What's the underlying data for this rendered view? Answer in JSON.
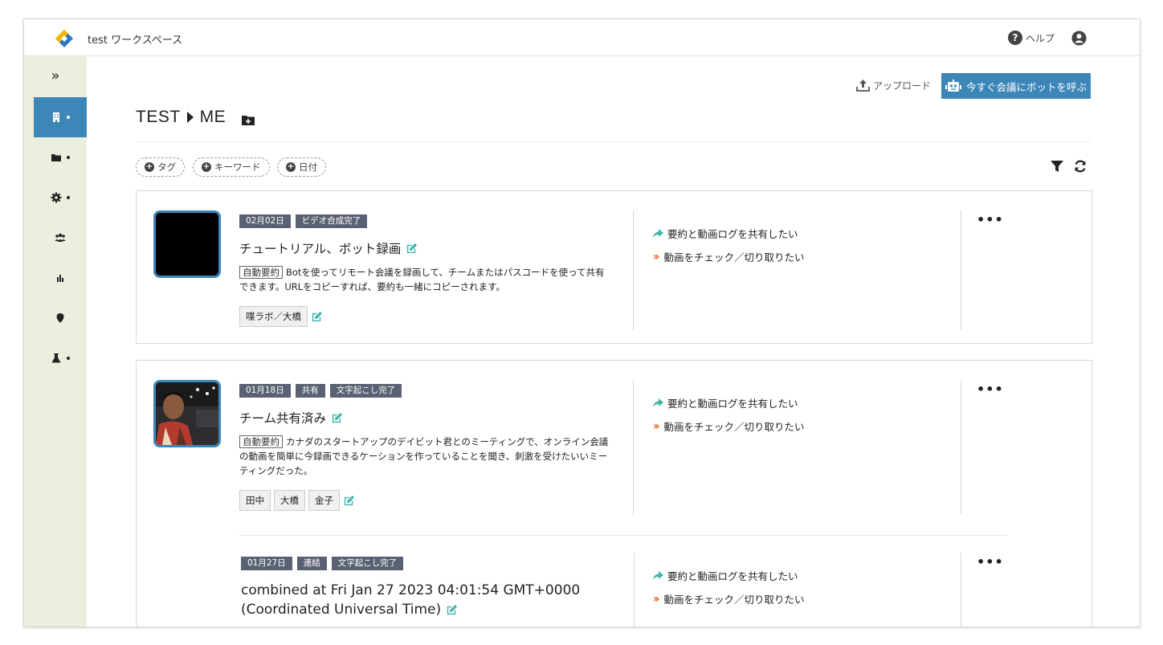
{
  "header": {
    "workspace": "test ワークスペース",
    "help_label": "ヘルプ",
    "colors": {
      "accent": "#3d86b8",
      "logo_yellow": "#f5b400",
      "logo_blue": "#2979c2"
    }
  },
  "sidebar": {
    "toggle": "»",
    "items": [
      {
        "icon": "building-icon",
        "active": true
      },
      {
        "icon": "folder-icon",
        "active": false
      },
      {
        "icon": "gear-icon",
        "active": false
      },
      {
        "icon": "users-icon",
        "active": false
      },
      {
        "icon": "chart-icon",
        "active": false
      },
      {
        "icon": "map-pin-icon",
        "active": false
      },
      {
        "icon": "flask-icon",
        "active": false
      }
    ]
  },
  "toolbar": {
    "upload_label": "アップロード",
    "bot_label": "今すぐ会議にボットを呼ぶ"
  },
  "breadcrumb": {
    "root": "TEST",
    "current": "ME"
  },
  "filters": {
    "tag": "タグ",
    "keyword": "キーワード",
    "date": "日付"
  },
  "actions": {
    "share": "要約と動画ログを共有したい",
    "check": "動画をチェック／切り取りたい"
  },
  "records": [
    {
      "date": "02月02日",
      "tags": [
        "ビデオ合成完了"
      ],
      "title": "チュートリアル、ボット録画",
      "auto_label": "自動要約",
      "summary": "Botを使ってリモート会議を録画して、チームまたはパスコードを使って共有できます。URLをコピーすれば、要約も一緒にコピーされます。",
      "people": [
        "喋ラボ／大橋"
      ]
    },
    {
      "date": "01月18日",
      "tags": [
        "共有",
        "文字起こし完了"
      ],
      "title": "チーム共有済み",
      "auto_label": "自動要約",
      "summary": "カナダのスタートアップのデイビット君とのミーティングで、オンライン会議の動画を簡単に今録画できるケーションを作っていることを聞き、刺激を受けたいいミーティングだった。",
      "people": [
        "田中",
        "大橋",
        "金子"
      ]
    },
    {
      "date": "01月27日",
      "tags": [
        "連結",
        "文字起こし完了"
      ],
      "title_line1": "combined at Fri Jan 27 2023 04:01:54 GMT+0000",
      "title_line2": "(Coordinated Universal Time)"
    }
  ]
}
